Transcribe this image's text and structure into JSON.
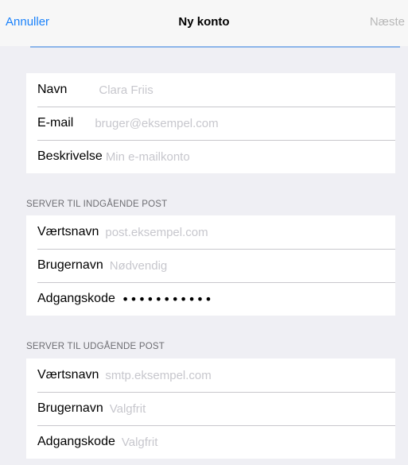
{
  "navbar": {
    "cancel_label": "Annuller",
    "title": "Ny konto",
    "next_label": "Næste"
  },
  "account": {
    "name": {
      "label": "Navn",
      "placeholder": "Clara Friis"
    },
    "email": {
      "label": "E-mail",
      "placeholder": "bruger@eksempel.com"
    },
    "description": {
      "label": "Beskrivelse",
      "placeholder": "Min e-mailkonto"
    }
  },
  "incoming": {
    "header": "SERVER TIL INDGÅENDE POST",
    "hostname": {
      "label": "Værtsnavn",
      "placeholder": "post.eksempel.com"
    },
    "username": {
      "label": "Brugernavn",
      "placeholder": "Nødvendig"
    },
    "password": {
      "label": "Adgangskode",
      "value": "•••••••••••"
    }
  },
  "outgoing": {
    "header": "SERVER TIL UDGÅENDE POST",
    "hostname": {
      "label": "Værtsnavn",
      "placeholder": "smtp.eksempel.com"
    },
    "username": {
      "label": "Brugernavn",
      "placeholder": "Valgfrit"
    },
    "password": {
      "label": "Adgangskode",
      "placeholder": "Valgfrit"
    }
  },
  "colors": {
    "accent": "#1a82fb",
    "disabled": "#b8b8b8",
    "background": "#efeff4"
  }
}
